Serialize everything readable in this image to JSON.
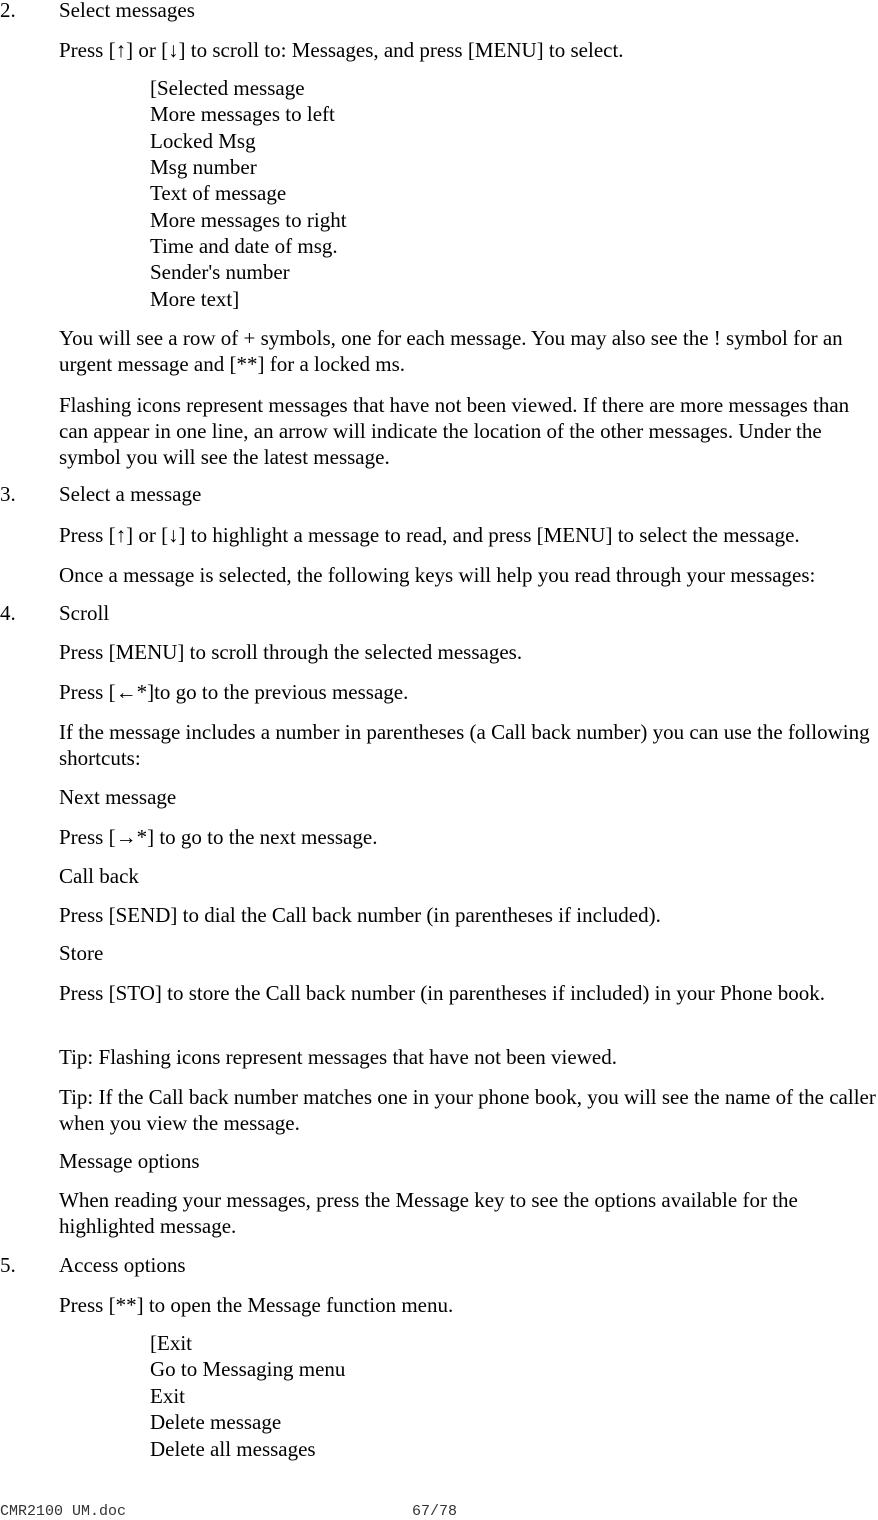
{
  "steps": [
    {
      "num": "2.",
      "title": "Select messages"
    },
    {
      "num": "3.",
      "title": "Select a message"
    },
    {
      "num": "4.",
      "title": "Scroll"
    },
    {
      "num": "5.",
      "title": "Access options"
    }
  ],
  "p1": "Press [↑] or [↓] to scroll to: Messages, and press [MENU] to select.",
  "screen1": [
    "[Selected message",
    "More messages to left",
    "Locked Msg",
    "Msg number",
    "Text of message",
    "More messages to right",
    "Time and date of msg.",
    "Sender's number",
    "More text]"
  ],
  "p2": "You will see a row of + symbols, one for each message. You may also see the ! symbol for an urgent message and [**] for a locked ms.",
  "p3": "Flashing icons represent messages that have not been viewed. If there are more messages than can appear in one line, an arrow will indicate the location of the other messages. Under the symbol you will see the latest message.",
  "p4": "Press [↑] or [↓] to highlight a message to read, and press [MENU] to select the message.",
  "p5": "Once a message is selected, the following keys will help you read through your messages:",
  "p6": "Press [MENU] to scroll through the selected messages.",
  "p7": "Press [←*]to go to the previous message.",
  "p8": "If the message includes a number in parentheses (a Call back number) you can use the following shortcuts:",
  "h_next": "Next message",
  "p9": "Press [→*] to go to the next message.",
  "h_callback": "Call back",
  "p10": "Press [SEND] to dial the Call back number (in parentheses if included).",
  "h_store": "Store",
  "p11": "Press [STO] to store the Call back number (in parentheses if included) in your Phone book.",
  "tip1": "Tip:  Flashing icons represent messages that have not been viewed.",
  "tip2": "Tip:  If the Call back number matches one in your phone book, you will see the name of the caller when you view the message.",
  "h_options": "Message options",
  "p12": "When reading your messages, press the Message key to see the options available for the highlighted message.",
  "p13": "Press [**] to open the Message function menu.",
  "screen2": [
    "[Exit",
    "Go to Messaging menu",
    "Exit",
    "Delete message",
    "Delete all messages"
  ],
  "footer": {
    "filename": "CMR2100 UM.doc",
    "page": "67/78"
  }
}
